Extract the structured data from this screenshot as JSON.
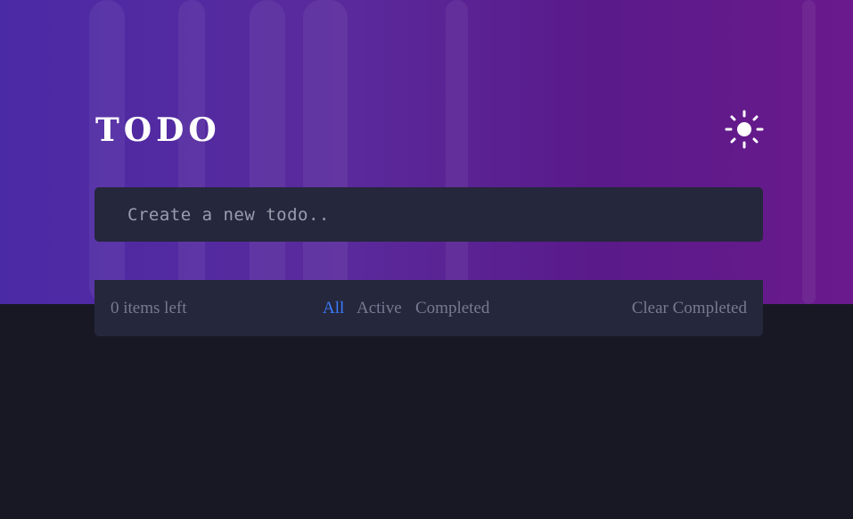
{
  "header": {
    "title": "TODO",
    "theme_toggle_icon": "sun-icon"
  },
  "new_todo": {
    "placeholder": "Create a new todo..",
    "value": ""
  },
  "footer": {
    "items_left": "0 items left",
    "filters": [
      {
        "label": "All",
        "active": true
      },
      {
        "label": "Active",
        "active": false
      },
      {
        "label": "Completed",
        "active": false
      }
    ],
    "clear_label": "Clear Completed"
  },
  "colors": {
    "accent": "#3a7bfd",
    "card": "#25273c",
    "background": "#181824",
    "muted_text": "#777a92"
  }
}
